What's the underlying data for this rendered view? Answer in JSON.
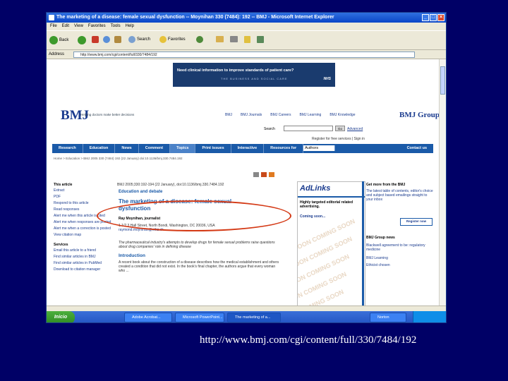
{
  "window": {
    "title": "The marketing of a disease: female sexual dysfunction -- Moynihan 330 (7484): 192 -- BMJ - Microsoft Internet Explorer"
  },
  "menu": [
    "File",
    "Edit",
    "View",
    "Favorites",
    "Tools",
    "Help"
  ],
  "toolbar": {
    "back_label": "Back",
    "search_label": "Search",
    "favorites_label": "Favorites"
  },
  "address": {
    "label": "Address",
    "value": "http://www.bmj.com/cgi/content/full/330/7484/192"
  },
  "banner": {
    "text": "Need clinical information to improve standards of patient care?",
    "sub": "THE BUSINESS AND SOCIAL CARE",
    "nhs": "NHS"
  },
  "site": {
    "logo": "BMJ",
    "tagline": "Helping doctors make better decisions",
    "group": "BMJ Group",
    "topnav": [
      "BMJ",
      "BMJ Journals",
      "BMJ Careers",
      "BMJ Learning",
      "BMJ Knowledge"
    ],
    "search_label": "Search",
    "go_label": "Go",
    "advanced_label": "Advanced",
    "signin": "Register for free services | Sign in"
  },
  "navbar": {
    "items": [
      "Research",
      "Education",
      "News",
      "Comment",
      "Topics",
      "Print issues",
      "Interactive"
    ],
    "resources_label": "Resources for",
    "resources_value": "Authors",
    "right": [
      "Contact us"
    ]
  },
  "breadcrumb": "Home > Education > BMJ 2005 330 (7484) 192 (22 January) doi:10.1136/bmj.330.7484.192",
  "leftnav": {
    "heading": "This article",
    "items": [
      "Extract",
      "PDF",
      "Respond to this article",
      "Read responses",
      "Alert me when this article is cited",
      "Alert me when responses are posted",
      "Alert me when a correction is posted",
      "View citation map"
    ],
    "services_heading": "Services",
    "services": [
      "Email this article to a friend",
      "Find similar articles in BMJ",
      "Find similar articles in PubMed",
      "Download to citation manager"
    ]
  },
  "article": {
    "citation": "BMJ 2005;330:192-194 (22 January), doi:10.1136/bmj.330.7484.192",
    "section": "Education and debate",
    "title": "The marketing of a disease: female sexual dysfunction",
    "author": "Ray Moynihan, journalist",
    "affiliation": "1 1/2 3 Hall Street, North Bondi, Washington, DC 20036, USA",
    "email": "raymond.moynihan@ethz.ch",
    "standfirst": "The pharmaceutical industry's attempts to develop drugs for female sexual problems raise questions about drug companies' role in defining disease",
    "intro_heading": "Introduction",
    "intro_text": "A recent book about the construction of a disease describes how the medical establishment and others created a condition that did not exist. In the book's final chapter, the authors argue that every woman who ..."
  },
  "ad": {
    "logo": "AdLinks",
    "desc": "Highly targeted editorial related advertising.",
    "coming": "Coming soon...",
    "watermark": "SOON COMING SOON"
  },
  "right": {
    "heading": "Get more from the BMJ",
    "text": "The latest table of contents, editor's choice and subject based emailings straight to your inbox",
    "register": "Register now",
    "news_heading": "BMJ Group news",
    "news": [
      "Blackwell agreement to be: regulatory medicine",
      "BMJ Learning",
      "Ethicist chosen"
    ]
  },
  "taskbar": {
    "start": "Inicio",
    "tasks": [
      "Adobe Acrobat...",
      "Microsoft PowerPoint...",
      "The marketing of a...",
      "Norton"
    ]
  },
  "caption": "http://www.bmj.com/cgi/content/full/330/7484/192",
  "colors": {
    "background": "#000066",
    "bmj_blue": "#1a5aa8",
    "highlight": "#d43a16"
  }
}
